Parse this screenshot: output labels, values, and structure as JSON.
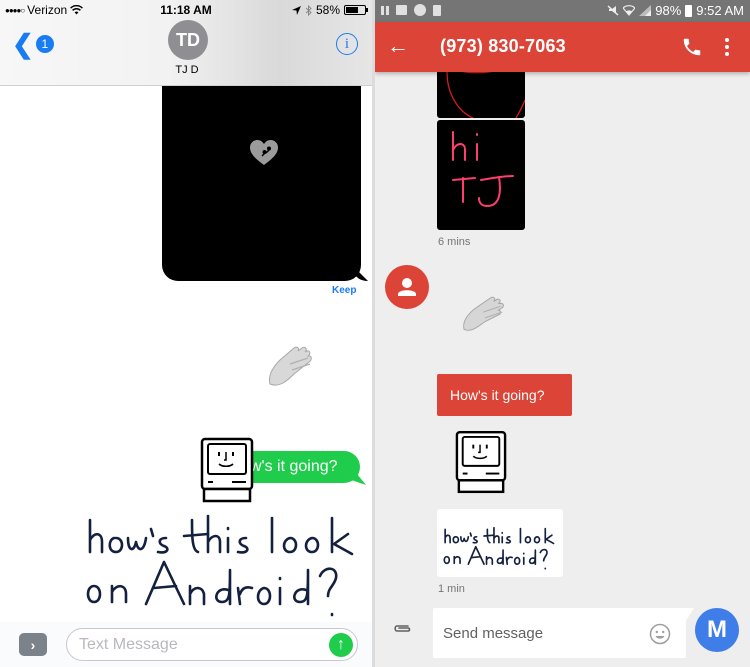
{
  "ios": {
    "status_bar": {
      "signal_dots": "●●●●○",
      "carrier": "Verizon",
      "time": "11:18 AM",
      "battery_percent": "58%",
      "battery_level": 0.58,
      "icons": [
        "wifi-icon",
        "location-arrow-icon",
        "bluetooth-icon",
        "battery-icon"
      ]
    },
    "nav": {
      "back_chevron": "❮",
      "unread_badge": "1",
      "contact_initials": "TD",
      "contact_name": "TJ D",
      "info_label": "i"
    },
    "messages": [
      {
        "type": "digital-touch-heartbeat",
        "side": "sent",
        "bg": "#000000",
        "icon": "heart-touch-icon"
      },
      {
        "type": "action-link",
        "text": "Keep"
      },
      {
        "type": "sticker",
        "icon": "clapping-hands-icon"
      },
      {
        "type": "text",
        "side": "sent",
        "text": "How's it going?",
        "visible_text": "w's it going?",
        "bg": "#1fcc4c",
        "overlay_sticker": "classic-mac-icon"
      },
      {
        "type": "handwriting",
        "side": "sent",
        "lines": [
          "how's this look",
          "on Android?"
        ]
      }
    ],
    "compose": {
      "apps_button": "›",
      "placeholder": "Text Message",
      "value": "",
      "send_icon": "↑"
    },
    "colors": {
      "accent": "#1a7cf2",
      "imessage_green": "#1fcc4c"
    }
  },
  "android": {
    "status_bar": {
      "left_icons": [
        "pause-icon",
        "calendar-icon",
        "pinwheel-icon",
        "battery-saver-icon"
      ],
      "right_icons": [
        "mute-icon",
        "wifi-icon",
        "signal-icon",
        "battery-icon"
      ],
      "battery_percent": "98%",
      "time": "9:52 AM"
    },
    "app_bar": {
      "back_icon": "←",
      "title": "(973) 830-7063",
      "actions": [
        "phone-icon",
        "more-vert-icon"
      ]
    },
    "messages": [
      {
        "type": "image",
        "content": "red circle drawing (partial)"
      },
      {
        "type": "image",
        "content": "hi TJ",
        "lines": [
          "hi",
          "TJ"
        ]
      },
      {
        "type": "timestamp",
        "text": "6 mins"
      },
      {
        "type": "sticker",
        "icon": "clapping-hands-icon"
      },
      {
        "type": "text",
        "text": "How's it going?",
        "bg": "#db4437"
      },
      {
        "type": "sticker",
        "icon": "classic-mac-icon"
      },
      {
        "type": "image",
        "content": "handwriting",
        "lines": [
          "how's this look",
          "on Android?"
        ]
      },
      {
        "type": "timestamp",
        "text": "1 min"
      }
    ],
    "compose": {
      "placeholder": "Send message",
      "value": "",
      "send_label": "M"
    },
    "colors": {
      "primary": "#db4437",
      "status_bar": "#757575",
      "background": "#eeeeee",
      "send": "#3f7ee8"
    }
  }
}
